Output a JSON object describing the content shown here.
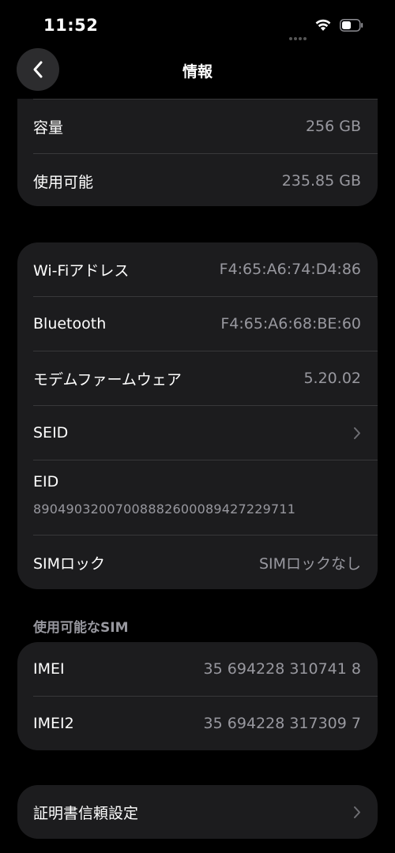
{
  "status_bar": {
    "time": "11:52"
  },
  "nav": {
    "title": "情報"
  },
  "storage": [
    {
      "label": "容量",
      "value": "256 GB"
    },
    {
      "label": "使用可能",
      "value": "235.85 GB"
    }
  ],
  "network": {
    "wifi_address": {
      "label": "Wi-Fiアドレス",
      "value": "F4:65:A6:74:D4:86"
    },
    "bluetooth": {
      "label": "Bluetooth",
      "value": "F4:65:A6:68:BE:60"
    },
    "modem_firmware": {
      "label": "モデムファームウェア",
      "value": "5.20.02"
    },
    "seid": {
      "label": "SEID"
    },
    "eid": {
      "label": "EID",
      "value": "89049032007008882600089427229711"
    },
    "sim_lock": {
      "label": "SIMロック",
      "value": "SIMロックなし"
    }
  },
  "available_sim": {
    "header": "使用可能なSIM",
    "imei": {
      "label": "IMEI",
      "value": "35 694228 310741 8"
    },
    "imei2": {
      "label": "IMEI2",
      "value": "35 694228 317309 7"
    }
  },
  "certificate": {
    "label": "証明書信頼設定"
  }
}
